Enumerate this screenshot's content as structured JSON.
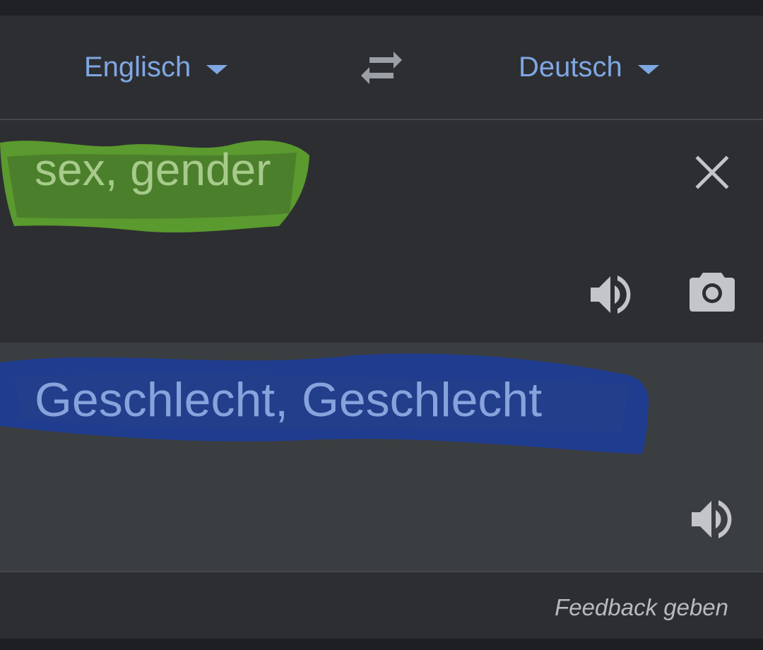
{
  "header": {
    "source_language": "Englisch",
    "target_language": "Deutsch",
    "swap_icon": "swap-horiz-icon"
  },
  "source": {
    "text": "sex, gender",
    "highlight_color": "#5a9a2e",
    "text_color": "#a7cb8a",
    "icons": [
      "close-icon",
      "speaker-icon",
      "camera-icon"
    ]
  },
  "translation": {
    "text": "Geschlecht, Geschlecht",
    "highlight_color": "#1f3c8f",
    "text_color": "#88a2dc",
    "icons": [
      "speaker-icon"
    ]
  },
  "footer": {
    "feedback_label": "Feedback geben"
  },
  "colors": {
    "accent": "#7fa7e3",
    "background": "#2d2e32",
    "translation_background": "#3b3e41"
  }
}
